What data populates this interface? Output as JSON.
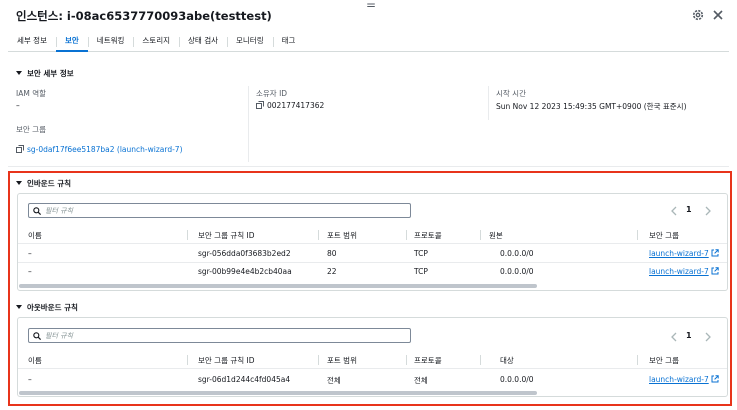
{
  "header": {
    "title": "인스턴스: i-08ac6537770093abe(testtest)",
    "drag_handle": "="
  },
  "tabs": [
    {
      "label": "세부 정보",
      "active": false
    },
    {
      "label": "보안",
      "active": true
    },
    {
      "label": "네트워킹",
      "active": false
    },
    {
      "label": "스토리지",
      "active": false
    },
    {
      "label": "상태 검사",
      "active": false
    },
    {
      "label": "모니터링",
      "active": false
    },
    {
      "label": "태그",
      "active": false
    }
  ],
  "security_details": {
    "title": "보안 세부 정보",
    "iam_role_label": "IAM 역할",
    "iam_role_value": "–",
    "owner_id_label": "소유자 ID",
    "owner_id_value": "002177417362",
    "launch_time_label": "시작 시간",
    "launch_time_value": "Sun Nov 12 2023 15:49:35 GMT+0900 (한국 표준시)",
    "security_groups_label": "보안 그룹",
    "security_group_value": "sg-0daf17f6ee5187ba2 (launch-wizard-7)"
  },
  "inbound": {
    "title": "인바운드 규칙",
    "filter_placeholder": "필터 규칙",
    "page": "1",
    "columns": [
      "이름",
      "보안 그룹 규칙 ID",
      "포트 범위",
      "프로토콜",
      "원본",
      "보안 그룹"
    ],
    "rows": [
      {
        "name": "–",
        "rule_id": "sgr-056dda0f3683b2ed2",
        "port": "80",
        "protocol": "TCP",
        "source": "0.0.0.0/0",
        "group": "launch-wizard-7"
      },
      {
        "name": "–",
        "rule_id": "sgr-00b99e4e4b2cb40aa",
        "port": "22",
        "protocol": "TCP",
        "source": "0.0.0.0/0",
        "group": "launch-wizard-7"
      }
    ]
  },
  "outbound": {
    "title": "아웃바운드 규칙",
    "filter_placeholder": "필터 규칙",
    "page": "1",
    "columns": [
      "이름",
      "보안 그룹 규칙 ID",
      "포트 범위",
      "프로토콜",
      "대상",
      "보안 그룹"
    ],
    "rows": [
      {
        "name": "–",
        "rule_id": "sgr-06d1d244c4fd045a4",
        "port": "전체",
        "protocol": "전체",
        "dest": "0.0.0.0/0",
        "group": "launch-wizard-7"
      }
    ]
  },
  "colors": {
    "link": "#0972d3",
    "highlight": "#e8341b",
    "text": "#16191f",
    "muted": "#545b64"
  }
}
